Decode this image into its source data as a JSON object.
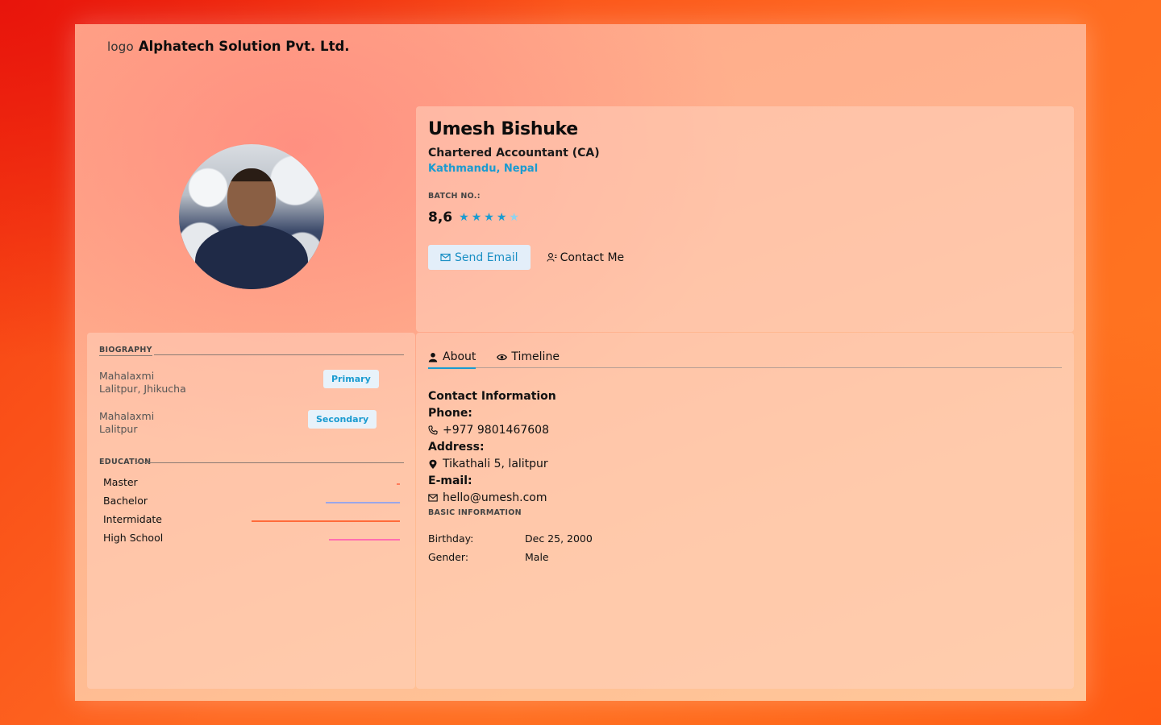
{
  "brand": {
    "logo_alt": "logo",
    "name": "Alphatech Solution Pvt. Ltd."
  },
  "profile": {
    "name": "Umesh Bishuke",
    "title": "Chartered Accountant (CA)",
    "location": "Kathmandu, Nepal",
    "batch_label": "BATCH NO.:",
    "rating_value": "8,6",
    "stars_filled": 4,
    "stars_total": 5,
    "send_email_label": "Send Email",
    "contact_label": "Contact Me"
  },
  "biography": {
    "label": "BIOGRAPHY",
    "addresses": [
      {
        "line1": "Mahalaxmi",
        "line2": "Lalitpur, Jhikucha",
        "badge": "Primary"
      },
      {
        "line1": "Mahalaxmi",
        "line2": "Lalitpur",
        "badge": "Secondary"
      }
    ]
  },
  "education": {
    "label": "EDUCATION",
    "items": [
      {
        "name": "Master",
        "color": "#ff7b5a",
        "level": 0.01
      },
      {
        "name": "Bachelor",
        "color": "#9aa6e8",
        "level": 0.25
      },
      {
        "name": "Intermidate",
        "color": "#ff6b3a",
        "level": 0.5
      },
      {
        "name": "High School",
        "color": "#ff6fb0",
        "level": 0.24
      }
    ]
  },
  "tabs": [
    {
      "label": "About",
      "icon": "user-icon",
      "active": true
    },
    {
      "label": "Timeline",
      "icon": "eye-icon",
      "active": false
    }
  ],
  "contact": {
    "title": "Contact Information",
    "phone_label": "Phone:",
    "phone": "+977 9801467608",
    "address_label": "Address:",
    "address": "Tikathali 5, lalitpur",
    "email_label": "E-mail:",
    "email": "hello@umesh.com"
  },
  "basic": {
    "label": "BASIC INFORMATION",
    "birthday_label": "Birthday:",
    "birthday": "Dec 25, 2000",
    "gender_label": "Gender:",
    "gender": "Male"
  },
  "colors": {
    "accent": "#1a9bd0"
  }
}
